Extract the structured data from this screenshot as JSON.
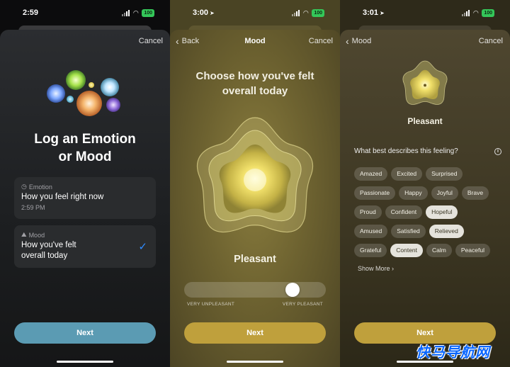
{
  "screen1": {
    "status_time": "2:59",
    "battery": "100",
    "nav": {
      "cancel": "Cancel"
    },
    "title_line1": "Log an Emotion",
    "title_line2": "or Mood",
    "emotion_card": {
      "label": "Emotion",
      "title": "How you feel right now",
      "sub": "2:59 PM"
    },
    "mood_card": {
      "label": "Mood",
      "title_line1": "How you've felt",
      "title_line2": "overall today"
    },
    "next": "Next",
    "colors": {
      "accent": "#5b9bb3",
      "check": "#2f8cff"
    }
  },
  "screen2": {
    "status_time": "3:00",
    "battery": "100",
    "nav": {
      "back": "Back",
      "title": "Mood",
      "cancel": "Cancel"
    },
    "question_line1": "Choose how you've felt",
    "question_line2": "overall today",
    "feeling": "Pleasant",
    "slider": {
      "value": 0.8,
      "min_label": "VERY UNPLEASANT",
      "max_label": "VERY PLEASANT"
    },
    "next": "Next",
    "colors": {
      "accent": "#bfa03c"
    }
  },
  "screen3": {
    "status_time": "3:01",
    "battery": "100",
    "nav": {
      "back": "Mood",
      "cancel": "Cancel"
    },
    "feeling": "Pleasant",
    "question": "What best describes this feeling?",
    "tag_rows": [
      [
        {
          "label": "Amazed",
          "selected": false
        },
        {
          "label": "Excited",
          "selected": false
        },
        {
          "label": "Surprised",
          "selected": false
        }
      ],
      [
        {
          "label": "Passionate",
          "selected": false
        },
        {
          "label": "Happy",
          "selected": false
        },
        {
          "label": "Joyful",
          "selected": false
        },
        {
          "label": "Brave",
          "selected": false
        }
      ],
      [
        {
          "label": "Proud",
          "selected": false
        },
        {
          "label": "Confident",
          "selected": false
        },
        {
          "label": "Hopeful",
          "selected": true
        }
      ],
      [
        {
          "label": "Amused",
          "selected": false
        },
        {
          "label": "Satisfied",
          "selected": false
        },
        {
          "label": "Relieved",
          "selected": true
        }
      ],
      [
        {
          "label": "Grateful",
          "selected": false
        },
        {
          "label": "Content",
          "selected": true
        },
        {
          "label": "Calm",
          "selected": false
        },
        {
          "label": "Peaceful",
          "selected": false
        }
      ]
    ],
    "show_more": "Show More",
    "next": "Next"
  },
  "watermark": "快马导航网"
}
